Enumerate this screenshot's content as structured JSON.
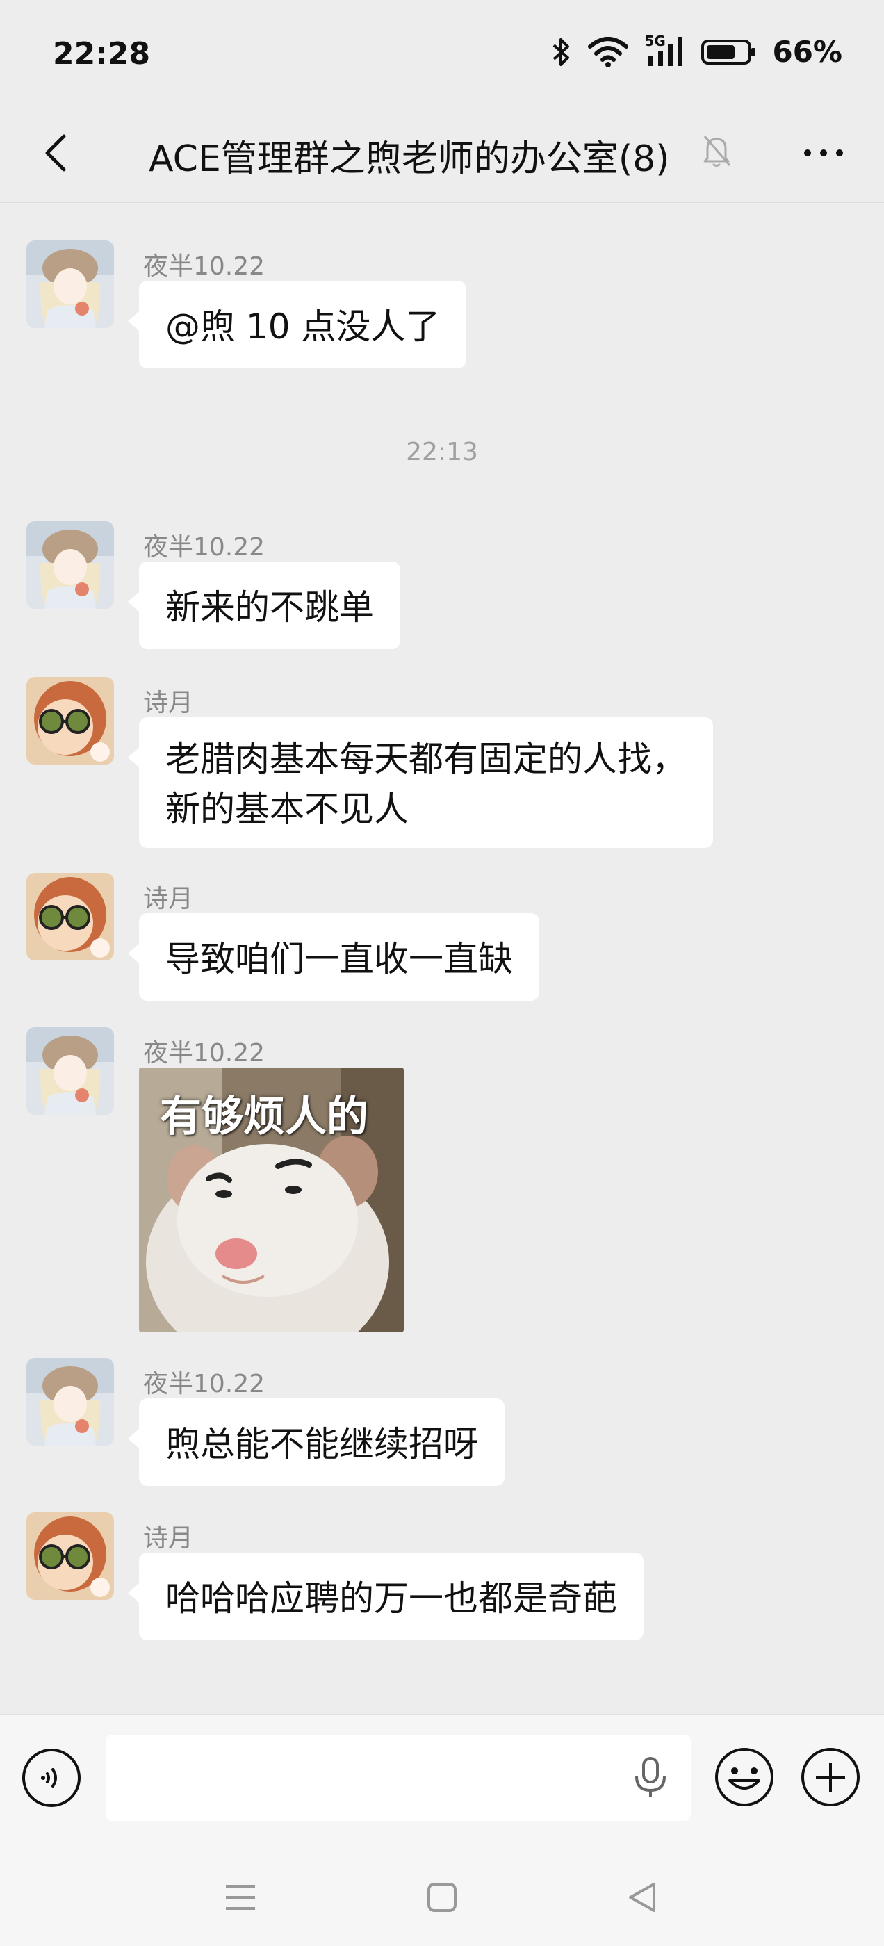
{
  "status_bar": {
    "time": "22:28",
    "battery": "66%",
    "network_label": "5G",
    "icons": [
      "bluetooth-icon",
      "wifi-icon",
      "signal-5g-icon",
      "battery-icon"
    ]
  },
  "header": {
    "title": "ACE管理群之煦老师的办公室(8)",
    "icons": [
      "back-icon",
      "mute-icon",
      "more-icon"
    ]
  },
  "messages": [
    {
      "sender": "夜半10.22",
      "avatar": "anime-girl",
      "type": "text",
      "text": "@煦  10 点没人了"
    },
    {
      "type": "timestamp",
      "text": "22:13"
    },
    {
      "sender": "夜半10.22",
      "avatar": "anime-girl",
      "type": "text",
      "text": "新来的不跳单"
    },
    {
      "sender": "诗月",
      "avatar": "glasses-face",
      "type": "text",
      "lines": [
        "老腊肉基本每天都有固定的人找，",
        "新的基本不见人"
      ]
    },
    {
      "sender": "诗月",
      "avatar": "glasses-face",
      "type": "text",
      "text": "导致咱们一直收一直缺"
    },
    {
      "sender": "夜半10.22",
      "avatar": "anime-girl",
      "type": "sticker",
      "sticker_text": "有够烦人的",
      "sticker_subject": "hamster"
    },
    {
      "sender": "夜半10.22",
      "avatar": "anime-girl",
      "type": "text",
      "text": "煦总能不能继续招呀"
    },
    {
      "sender": "诗月",
      "avatar": "glasses-face",
      "type": "text",
      "text": "哈哈哈应聘的万一也都是奇葩"
    }
  ],
  "input_bar": {
    "placeholder": "",
    "icons": [
      "voice-icon",
      "mic-icon",
      "emoji-icon",
      "plus-icon"
    ]
  },
  "system_nav": {
    "icons": [
      "menu-icon",
      "home-icon",
      "back-triangle-icon"
    ]
  },
  "colors": {
    "background": "#ededed",
    "bubble": "#ffffff",
    "sender_name": "#888888",
    "timestamp": "#a0a0a0"
  }
}
